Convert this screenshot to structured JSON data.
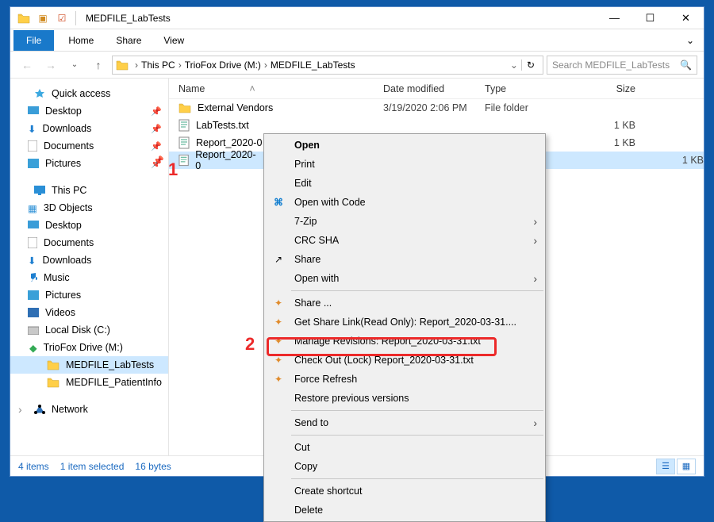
{
  "window": {
    "title": "MEDFILE_LabTests"
  },
  "ribbon": {
    "file": "File",
    "tabs": [
      "Home",
      "Share",
      "View"
    ]
  },
  "address": {
    "crumbs": [
      "This PC",
      "TrioFox Drive (M:)",
      "MEDFILE_LabTests"
    ],
    "search_placeholder": "Search MEDFILE_LabTests"
  },
  "nav": {
    "quick_access": {
      "label": "Quick access",
      "items": [
        "Desktop",
        "Downloads",
        "Documents",
        "Pictures"
      ]
    },
    "this_pc": {
      "label": "This PC",
      "items": [
        "3D Objects",
        "Desktop",
        "Documents",
        "Downloads",
        "Music",
        "Pictures",
        "Videos",
        "Local Disk (C:)",
        "TrioFox Drive (M:)"
      ],
      "m_children": [
        "MEDFILE_LabTests",
        "MEDFILE_PatientInfo"
      ]
    },
    "network": {
      "label": "Network"
    }
  },
  "columns": {
    "name": "Name",
    "date": "Date modified",
    "type": "Type",
    "size": "Size"
  },
  "files": [
    {
      "name": "External Vendors",
      "date": "3/19/2020 2:06 PM",
      "type": "File folder",
      "size": ""
    },
    {
      "name": "LabTests.txt",
      "date": "",
      "type": "",
      "size": "1 KB"
    },
    {
      "name": "Report_2020-0",
      "date": "",
      "type": "",
      "size": "1 KB"
    },
    {
      "name": "Report_2020-0",
      "date": "",
      "type": "",
      "size": "1 KB"
    }
  ],
  "context_menu": {
    "open": "Open",
    "print": "Print",
    "edit": "Edit",
    "open_with_code": "Open with Code",
    "seven_zip": "7-Zip",
    "crc_sha": "CRC SHA",
    "share": "Share",
    "open_with": "Open with",
    "share_ellipsis": "Share ...",
    "get_share_link": "Get Share Link(Read Only): Report_2020-03-31....",
    "manage_revisions": "Manage Revisions: Report_2020-03-31.txt",
    "check_out": "Check Out (Lock) Report_2020-03-31.txt",
    "force_refresh": "Force Refresh",
    "restore_previous": "Restore previous versions",
    "send_to": "Send to",
    "cut": "Cut",
    "copy": "Copy",
    "create_shortcut": "Create shortcut",
    "delete": "Delete"
  },
  "status": {
    "items": "4 items",
    "selected": "1 item selected",
    "bytes": "16 bytes"
  },
  "annotations": {
    "one": "1",
    "two": "2"
  }
}
